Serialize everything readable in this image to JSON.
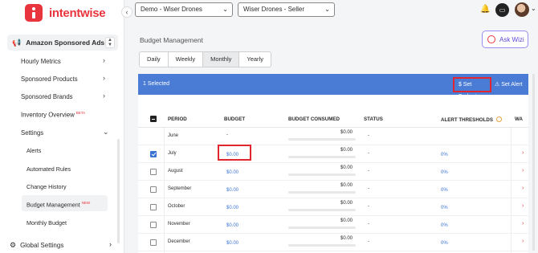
{
  "brand": {
    "name": "intentwise"
  },
  "header": {
    "account_dropdown": "Demo - Wiser Drones",
    "profile_dropdown": "Wiser Drones - Seller"
  },
  "sidebar": {
    "section": "Amazon Sponsored Ads",
    "items": [
      {
        "label": "Hourly Metrics"
      },
      {
        "label": "Sponsored Products"
      },
      {
        "label": "Sponsored Brands"
      },
      {
        "label": "Inventory Overview",
        "badge": "BETA"
      },
      {
        "label": "Settings"
      }
    ],
    "settings_items": [
      {
        "label": "Alerts"
      },
      {
        "label": "Automated Rules"
      },
      {
        "label": "Change History"
      },
      {
        "label": "Budget Management",
        "badge": "NEW"
      },
      {
        "label": "Monthly Budget"
      }
    ],
    "footer": "Global Settings"
  },
  "main": {
    "title": "Budget Management",
    "ask_button": "Ask Wizi",
    "tabs": [
      "Daily",
      "Weekly",
      "Monthly",
      "Yearly"
    ],
    "active_tab": "Monthly",
    "selection": {
      "count_text": "1 Selected",
      "set_budget": "$ Set Budget",
      "set_alert": "Set Alert"
    },
    "columns": [
      "PERIOD",
      "BUDGET",
      "BUDGET CONSUMED",
      "STATUS",
      "ALERT THRESHOLDS",
      "WA"
    ],
    "rows": [
      {
        "period": "June",
        "budget": "-",
        "consumed": "$0.00",
        "status": "-",
        "alert": "",
        "checked": false,
        "has_checkbox": false
      },
      {
        "period": "July",
        "budget": "$0.00",
        "consumed": "$0.00",
        "status": "-",
        "alert": "0%",
        "checked": true,
        "has_checkbox": true
      },
      {
        "period": "August",
        "budget": "$0.00",
        "consumed": "$0.00",
        "status": "-",
        "alert": "0%",
        "checked": false,
        "has_checkbox": true
      },
      {
        "period": "September",
        "budget": "$0.00",
        "consumed": "$0.00",
        "status": "-",
        "alert": "0%",
        "checked": false,
        "has_checkbox": true
      },
      {
        "period": "October",
        "budget": "$0.00",
        "consumed": "$0.00",
        "status": "-",
        "alert": "0%",
        "checked": false,
        "has_checkbox": true
      },
      {
        "period": "November",
        "budget": "$0.00",
        "consumed": "$0.00",
        "status": "-",
        "alert": "0%",
        "checked": false,
        "has_checkbox": true
      },
      {
        "period": "December",
        "budget": "$0.00",
        "consumed": "$0.00",
        "status": "-",
        "alert": "0%",
        "checked": false,
        "has_checkbox": true
      }
    ]
  },
  "colors": {
    "brand_red": "#e8343c",
    "selection_bar": "#4a7cd6",
    "link_blue": "#3b73d4",
    "highlight": "#e0262e"
  },
  "icons": [
    "megaphone-icon",
    "chevron-right-icon",
    "chevron-down-icon",
    "gear-icon",
    "bell-icon",
    "chat-icon",
    "dollar-icon",
    "alert-icon",
    "info-icon"
  ]
}
